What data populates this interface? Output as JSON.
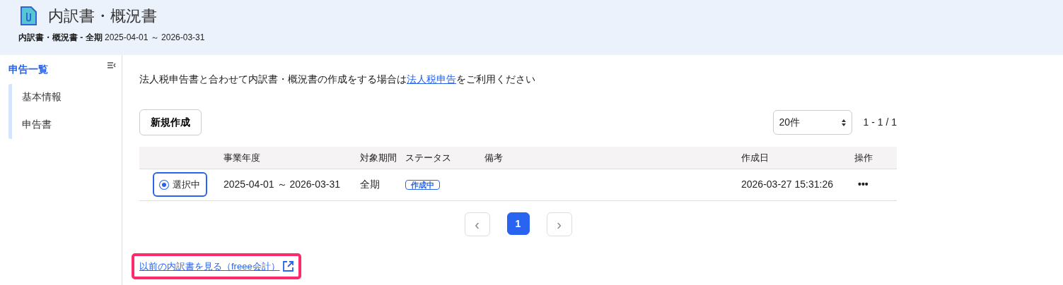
{
  "header": {
    "title": "内訳書・概況書",
    "subtitle": "**内訳書・概況書 - 全期** 2025-04-01 ～ 2026-03-31"
  },
  "sidebar": {
    "title": "申告一覧",
    "items": [
      {
        "label": "基本情報",
        "selected": false
      },
      {
        "label": "申告書",
        "selected": false
      }
    ]
  },
  "notice": {
    "before": "法人税申告書と合わせて内訳書・概況書の作成をする場合は",
    "link": "法人税申告",
    "after": "をご利用ください"
  },
  "new_button": "新規作成",
  "page_size": "20件",
  "range": "1 - 1 / 1",
  "table": {
    "columns": [
      "事業年度",
      "対象期間",
      "ステータス",
      "備考",
      "作成日",
      "操作"
    ],
    "rows": [
      {
        "radio_label": "選択中",
        "selected": true,
        "fiscal_year": "2025-04-01 ～ 2026-03-31",
        "period": "全期",
        "status": "作成中",
        "note": "",
        "created": "2026-03-27 15:31:26",
        "action": "•••"
      }
    ]
  },
  "pagination": {
    "prev": "‹",
    "pages": [
      {
        "label": "1",
        "selected": true
      }
    ],
    "next": "›"
  },
  "old_link": "以前の内訳書を見る（freee会計）"
}
